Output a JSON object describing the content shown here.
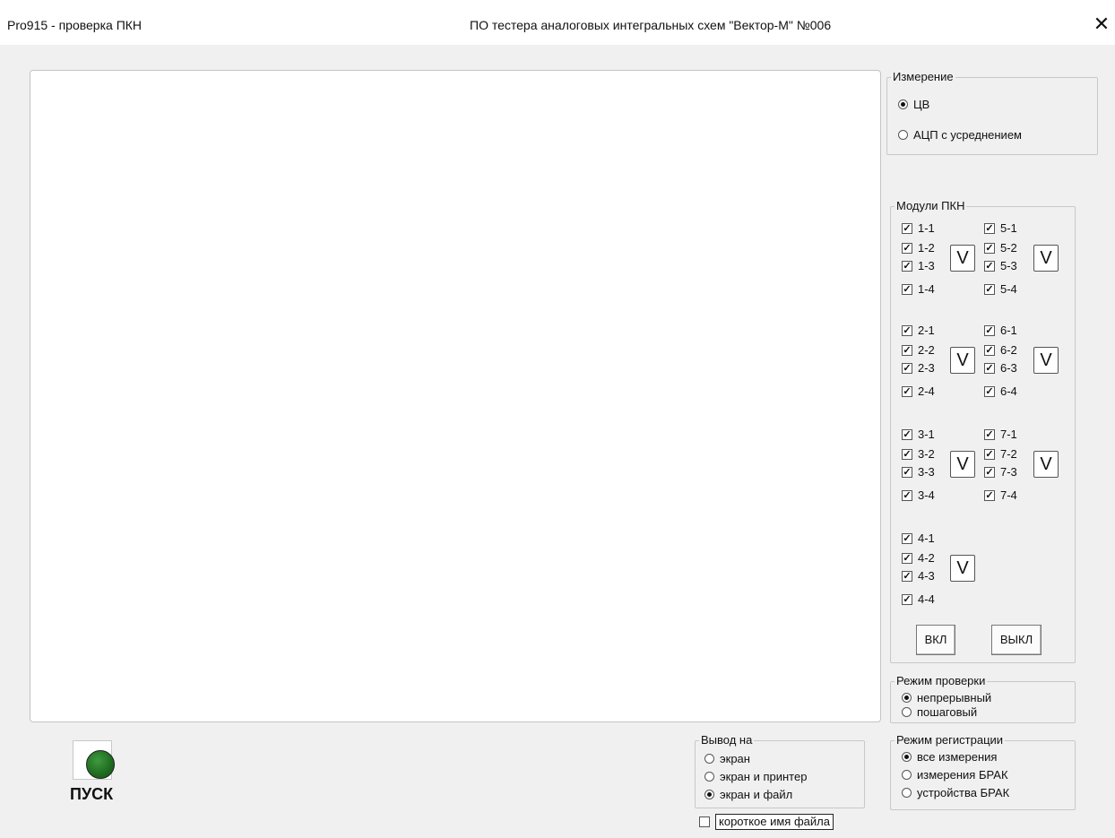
{
  "window": {
    "app_title": "Pro915 - проверка ПКН",
    "center_title": "ПО тестера аналоговых интегральных схем \"Вектор-М\" №006",
    "close_glyph": "✕"
  },
  "measurement": {
    "legend": "Измерение",
    "options": [
      {
        "label": "ЦВ",
        "selected": true
      },
      {
        "label": "АЦП с усреднением",
        "selected": false
      }
    ]
  },
  "modules": {
    "legend": "Модули ПКН",
    "groups": [
      {
        "items": [
          "1-1",
          "1-2",
          "1-3",
          "1-4"
        ],
        "checked": true,
        "toggle": "V"
      },
      {
        "items": [
          "5-1",
          "5-2",
          "5-3",
          "5-4"
        ],
        "checked": true,
        "toggle": "V"
      },
      {
        "items": [
          "2-1",
          "2-2",
          "2-3",
          "2-4"
        ],
        "checked": true,
        "toggle": "V"
      },
      {
        "items": [
          "6-1",
          "6-2",
          "6-3",
          "6-4"
        ],
        "checked": true,
        "toggle": "V"
      },
      {
        "items": [
          "3-1",
          "3-2",
          "3-3",
          "3-4"
        ],
        "checked": true,
        "toggle": "V"
      },
      {
        "items": [
          "7-1",
          "7-2",
          "7-3",
          "7-4"
        ],
        "checked": true,
        "toggle": "V"
      },
      {
        "items": [
          "4-1",
          "4-2",
          "4-3",
          "4-4"
        ],
        "checked": true,
        "toggle": "V"
      }
    ],
    "on_label": "ВКЛ",
    "off_label": "ВЫКЛ"
  },
  "check_mode": {
    "legend": "Режим проверки",
    "options": [
      {
        "label": "непрерывный",
        "selected": true
      },
      {
        "label": "пошаговый",
        "selected": false
      }
    ]
  },
  "output": {
    "legend": "Вывод на",
    "options": [
      {
        "label": "экран",
        "selected": false
      },
      {
        "label": "экран и принтер",
        "selected": false
      },
      {
        "label": "экран и файл",
        "selected": true
      }
    ],
    "short_name_label": "короткое имя файла",
    "short_name_checked": false
  },
  "register_mode": {
    "legend": "Режим регистрации",
    "options": [
      {
        "label": "все измерения",
        "selected": true
      },
      {
        "label": "измерения БРАК",
        "selected": false
      },
      {
        "label": "устройства БРАК",
        "selected": false
      }
    ]
  },
  "start": {
    "label": "ПУСК",
    "led_color": "#2a7a2a"
  }
}
